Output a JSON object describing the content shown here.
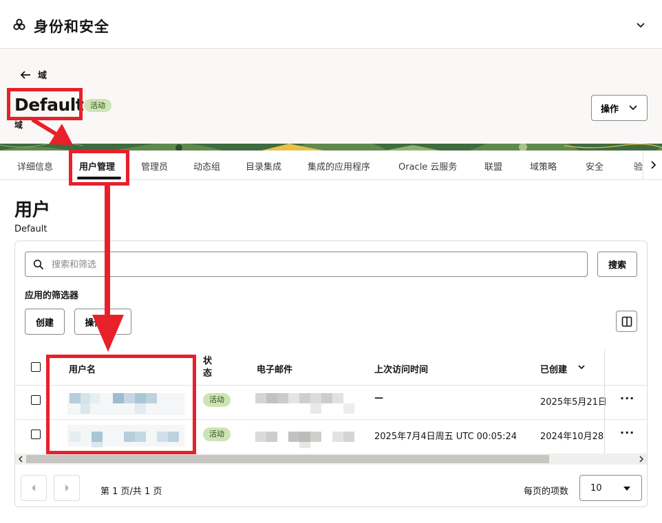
{
  "app": {
    "title": "身份和安全",
    "logo_icon": "oracle-cluster-icon"
  },
  "header": {
    "back_label": "域",
    "title": "Default",
    "status": "活动",
    "subtitle": "域",
    "actions_label": "操作"
  },
  "tabs": [
    {
      "label": "详细信息"
    },
    {
      "label": "用户管理",
      "active": true
    },
    {
      "label": "管理员"
    },
    {
      "label": "动态组"
    },
    {
      "label": "目录集成"
    },
    {
      "label": "集成的应用程序"
    },
    {
      "label": "Oracle 云服务"
    },
    {
      "label": "联盟"
    },
    {
      "label": "域策略"
    },
    {
      "label": "安全"
    },
    {
      "label": "验"
    }
  ],
  "section": {
    "title": "用户",
    "subtitle": "Default"
  },
  "search": {
    "placeholder": "搜索和筛选",
    "button": "搜索"
  },
  "filters_label": "应用的筛选器",
  "toolbar": {
    "create": "创建",
    "actions": "操作"
  },
  "table": {
    "headers": {
      "username": "用户名",
      "status": "状态",
      "email": "电子邮件",
      "last_access": "上次访问时间",
      "created": "已创建"
    },
    "rows": [
      {
        "status": "活动",
        "last_access": "—",
        "created": "2025年5月21日"
      },
      {
        "status": "活动",
        "last_access": "2025年7月4日周五 UTC 00:05:24",
        "created": "2024年10月28"
      }
    ],
    "more_label": "···"
  },
  "pagination": {
    "page_info": "第 1 页/共 1 页",
    "per_page_label": "每页的项数",
    "per_page_value": "10"
  },
  "colors": {
    "annotation": "#e8202a",
    "status_badge_bg": "#cde4b6",
    "banner_green": "#3f6b40"
  }
}
